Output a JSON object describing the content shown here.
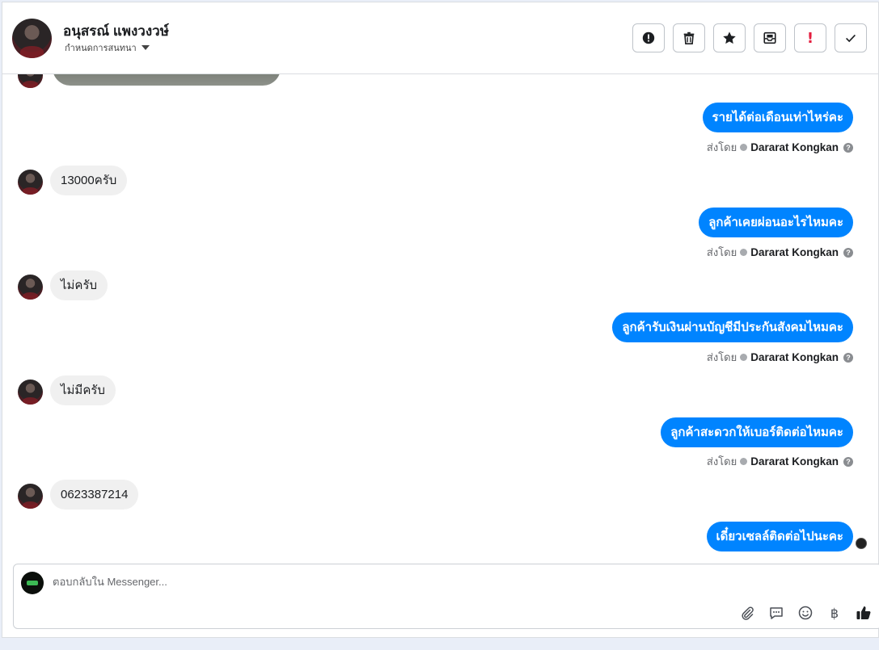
{
  "header": {
    "contact_name": "อนุสรณ์ แพงวงวษ์",
    "assign_label": "กำหนดการสนทนา",
    "actions": [
      {
        "name": "report-spam-button",
        "icon": "exclamation-circle-icon"
      },
      {
        "name": "delete-button",
        "icon": "trash-icon"
      },
      {
        "name": "star-button",
        "icon": "star-icon"
      },
      {
        "name": "move-to-inbox-button",
        "icon": "inbox-icon"
      },
      {
        "name": "mark-important-button",
        "icon": "exclamation-icon",
        "glyph": "!"
      },
      {
        "name": "mark-done-button",
        "icon": "checkmark-icon"
      }
    ]
  },
  "messages": [
    {
      "direction": "in",
      "text": "13000ครับ"
    },
    {
      "direction": "out",
      "text": "รายได้ต่อเดือนเท่าไหร่คะ",
      "sent_by_label": "ส่งโดย",
      "sender": "Dararat Kongkan"
    },
    {
      "direction": "out",
      "text": "ลูกค้าเคยผ่อนอะไรไหมคะ",
      "sent_by_label": "ส่งโดย",
      "sender": "Dararat Kongkan"
    },
    {
      "direction": "in",
      "text": "ไม่ครับ"
    },
    {
      "direction": "out",
      "text": "ลูกค้ารับเงินผ่านบัญชีมีประกันสังคมไหมคะ",
      "sent_by_label": "ส่งโดย",
      "sender": "Dararat Kongkan"
    },
    {
      "direction": "in",
      "text": "ไม่มีครับ"
    },
    {
      "direction": "out",
      "text": "ลูกค้าสะดวกให้เบอร์ติดต่อไหมคะ",
      "sent_by_label": "ส่งโดย",
      "sender": "Dararat Kongkan"
    },
    {
      "direction": "in",
      "text": "0623387214"
    },
    {
      "direction": "out",
      "text": "เดี๋ยวเซลล์ติดต่อไปนะคะ"
    }
  ],
  "composer": {
    "placeholder": "ตอบกลับใน Messenger...",
    "value": "",
    "tools": [
      "paperclip-icon",
      "saved-replies-icon",
      "emoji-icon",
      "baht-icon",
      "thumbs-up-icon"
    ],
    "baht_glyph": "฿"
  },
  "colors": {
    "outgoing_bubble": "#0084ff",
    "incoming_bubble": "#f0f0f0",
    "background": "#e9eef8"
  }
}
